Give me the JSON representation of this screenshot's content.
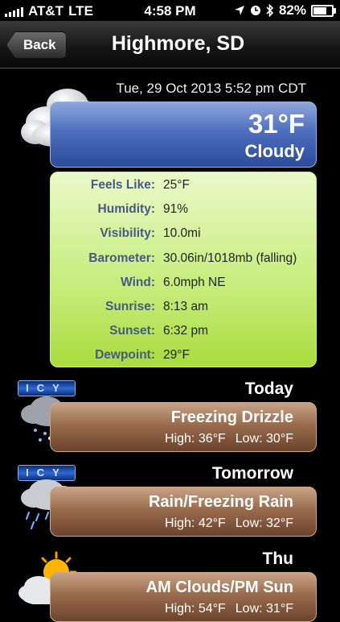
{
  "status_bar": {
    "carrier": "AT&T",
    "network": "LTE",
    "time": "4:58 PM",
    "battery": "82%",
    "battery_level": 0.82
  },
  "nav": {
    "back_label": "Back",
    "title": "Highmore, SD"
  },
  "current": {
    "timestamp": "Tue, 29 Oct 2013 5:52 pm CDT",
    "temperature": "31°F",
    "condition": "Cloudy",
    "icon": "cloud-icon"
  },
  "details": [
    {
      "label": "Feels Like:",
      "value": "25°F"
    },
    {
      "label": "Humidity:",
      "value": "91%"
    },
    {
      "label": "Visibility:",
      "value": "10.0mi"
    },
    {
      "label": "Barometer:",
      "value": "30.06in/1018mb (falling)"
    },
    {
      "label": "Wind:",
      "value": "6.0mph NE"
    },
    {
      "label": "Sunrise:",
      "value": "8:13 am"
    },
    {
      "label": "Sunset:",
      "value": "6:32 pm"
    },
    {
      "label": "Dewpoint:",
      "value": "29°F"
    }
  ],
  "forecast": [
    {
      "day": "Today",
      "badge": "ICY",
      "icon": "freezing-drizzle-icon",
      "description": "Freezing Drizzle",
      "high": "High: 36°F",
      "low": "Low: 30°F"
    },
    {
      "day": "Tomorrow",
      "badge": "ICY",
      "icon": "freezing-rain-icon",
      "description": "Rain/Freezing Rain",
      "high": "High: 42°F",
      "low": "Low: 32°F"
    },
    {
      "day": "Thu",
      "badge": "",
      "icon": "partly-sunny-icon",
      "description": "AM Clouds/PM Sun",
      "high": "High: 54°F",
      "low": "Low: 31°F"
    }
  ],
  "colors": {
    "current_card": "#4e6fbe",
    "details_card": "#c6ec7a",
    "forecast_card": "#9a6c4e",
    "detail_label": "#465a82"
  }
}
